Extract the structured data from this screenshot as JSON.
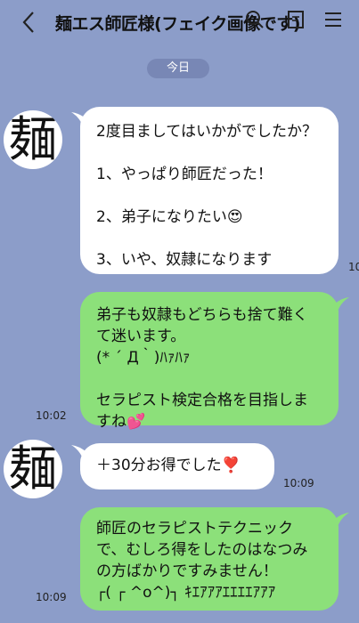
{
  "header": {
    "back_icon": "chevron-left-icon",
    "title": "麺エス師匠様(フェイク画像です)",
    "icons": [
      "search-icon",
      "note-icon",
      "menu-icon"
    ]
  },
  "date_separator": "今日",
  "avatar_char": "麺",
  "messages": [
    {
      "side": "left",
      "text": "2度目ましてはいかがでしたか？\n\n1、やっぱり師匠だった！\n\n2、弟子になりたい😍\n\n3、いや、奴隷になります",
      "time": "10"
    },
    {
      "side": "right",
      "text": "弟子も奴隷もどちらも捨て難くて迷います。\n(* ´ Д｀)ﾊｧﾊｧ\n\nセラピスト検定合格を目指しますね💕",
      "time": "10:02"
    },
    {
      "side": "left",
      "text": "＋30分お得でした❣️",
      "time": "10:09"
    },
    {
      "side": "right",
      "text": "師匠のセラピストテクニックで、むしろ得をしたのはなつみの方ばかりですみません！\n┌( ┌ ^o^)┐ ｷｴｱｱｱｴｴｴｴｱｱｱ",
      "time": "10:09"
    }
  ]
}
